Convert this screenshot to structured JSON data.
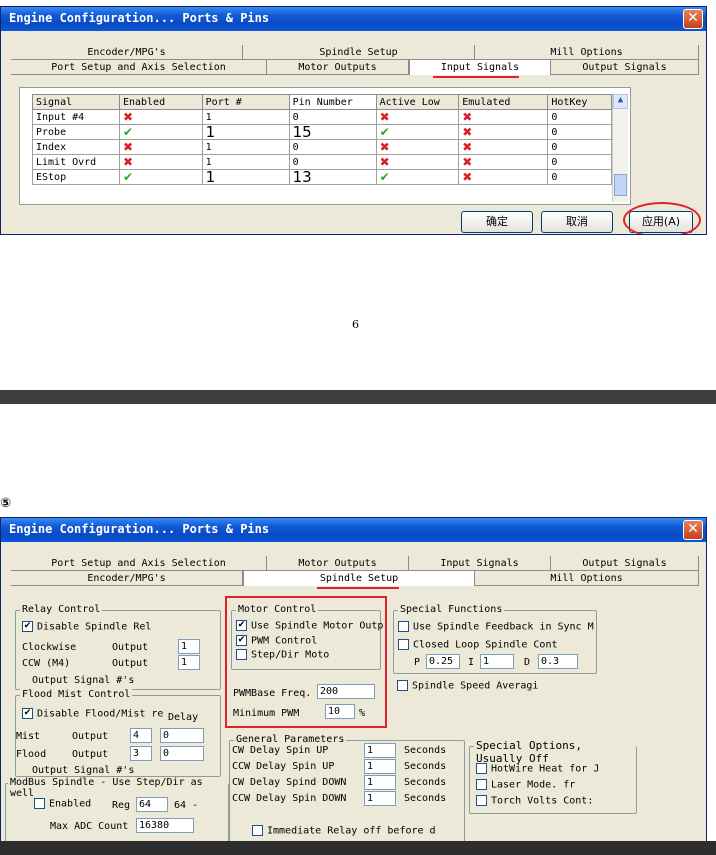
{
  "step4_marker": "",
  "step5_marker": "⑤",
  "window1": {
    "title": "Engine Configuration... Ports & Pins",
    "tabs_row1": [
      "Encoder/MPG's",
      "Spindle Setup",
      "Mill Options"
    ],
    "tabs_row2": [
      "Port Setup and Axis Selection",
      "Motor Outputs",
      "Input Signals",
      "Output Signals"
    ],
    "active_tab": "Input Signals",
    "table": {
      "headers": [
        "Signal",
        "Enabled",
        "Port #",
        "Pin Number",
        "Active Low",
        "Emulated",
        "HotKey"
      ],
      "rows": [
        {
          "signal": "Input #4",
          "enabled": "x",
          "port": "1",
          "pin": "0",
          "active_low": "x",
          "emulated": "x",
          "hotkey": "0",
          "big": false
        },
        {
          "signal": "Probe",
          "enabled": "check",
          "port": "1",
          "pin": "15",
          "active_low": "check",
          "emulated": "x",
          "hotkey": "0",
          "big": true
        },
        {
          "signal": "Index",
          "enabled": "x",
          "port": "1",
          "pin": "0",
          "active_low": "x",
          "emulated": "x",
          "hotkey": "0",
          "big": false
        },
        {
          "signal": "Limit Ovrd",
          "enabled": "x",
          "port": "1",
          "pin": "0",
          "active_low": "x",
          "emulated": "x",
          "hotkey": "0",
          "big": false
        },
        {
          "signal": "EStop",
          "enabled": "check",
          "port": "1",
          "pin": "13",
          "active_low": "check",
          "emulated": "x",
          "hotkey": "0",
          "big": true
        }
      ]
    },
    "buttons": {
      "ok": "确定",
      "cancel": "取消",
      "apply": "应用(A)"
    }
  },
  "page_number": "6",
  "window2": {
    "title": "Engine Configuration... Ports & Pins",
    "tabs_row1": [
      "Port Setup and Axis Selection",
      "Motor Outputs",
      "Input Signals",
      "Output Signals"
    ],
    "tabs_row2": [
      "Encoder/MPG's",
      "Spindle Setup",
      "Mill Options"
    ],
    "active_tab": "Spindle Setup",
    "relay_control": {
      "label": "Relay Control",
      "disable": "Disable Spindle Rel",
      "cw_label": "Clockwise",
      "cw_output": "Output",
      "cw_value": "1",
      "ccw_label": "CCW (M4)",
      "ccw_output": "Output",
      "ccw_value": "1",
      "output_signals": "Output Signal #'s"
    },
    "flood_mist": {
      "label": "Flood Mist Control",
      "disable": "Disable Flood/Mist re",
      "delay": "Delay",
      "mist_label": "Mist",
      "mist_output": "Output",
      "mist_value": "4",
      "mist_delay": "0",
      "flood_label": "Flood",
      "flood_output": "Output",
      "flood_value": "3",
      "flood_delay": "0",
      "output_signals": "Output Signal #'s"
    },
    "modbus": {
      "label": "ModBus Spindle - Use Step/Dir as well",
      "enabled": "Enabled",
      "reg_label": "Reg",
      "reg_value": "64",
      "reg_suffix": "64 -",
      "max_adc_label": "Max ADC Count",
      "max_adc_value": "16380"
    },
    "motor_control": {
      "label": "Motor Control",
      "use_spindle": "Use Spindle Motor Outp",
      "pwm": "PWM Control",
      "stepdir": "Step/Dir Moto",
      "pwm_base_label": "PWMBase Freq.",
      "pwm_base_value": "200",
      "min_pwm_label": "Minimum PWM",
      "min_pwm_value": "10",
      "min_pwm_unit": "%"
    },
    "general": {
      "label": "General Parameters",
      "rows": [
        {
          "label": "CW Delay Spin UP",
          "value": "1",
          "unit": "Seconds"
        },
        {
          "label": "CCW Delay Spin UP",
          "value": "1",
          "unit": "Seconds"
        },
        {
          "label": "CW Delay Spind DOWN",
          "value": "1",
          "unit": "Seconds"
        },
        {
          "label": "CCW Delay Spin DOWN",
          "value": "1",
          "unit": "Seconds"
        }
      ],
      "immediate": "Immediate Relay off before d"
    },
    "special_functions": {
      "label": "Special Functions",
      "feedback": "Use Spindle Feedback in Sync M",
      "closed_loop": "Closed Loop Spindle Cont",
      "p_label": "P",
      "p_value": "0.25",
      "i_label": "I",
      "i_value": "1",
      "d_label": "D",
      "d_value": "0.3",
      "speed_avg": "Spindle Speed Averagi"
    },
    "special_options": {
      "label": "Special Options, Usually Off",
      "hotwire": "HotWire Heat for J",
      "laser": "Laser Mode. fr",
      "torch": "Torch Volts Cont:"
    }
  },
  "colors": {
    "accent_red": "#e2202a",
    "titlebar_blue": "#0a4bc4",
    "check_green": "#2ba82b"
  }
}
